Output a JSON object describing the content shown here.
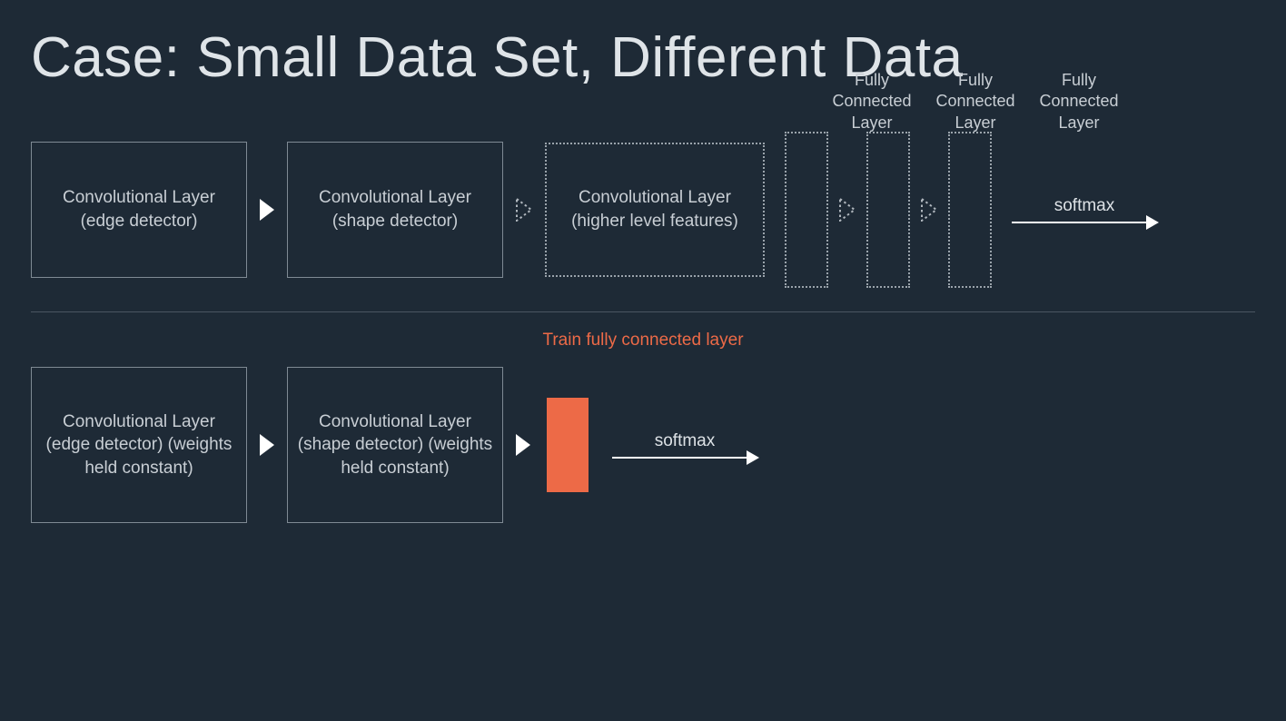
{
  "title": "Case: Small Data Set, Different Data",
  "top": {
    "conv1": "Convolutional Layer (edge detector)",
    "conv2": "Convolutional Layer (shape detector)",
    "conv3": "Convolutional Layer (higher level features)",
    "fc_label": "Fully Connected Layer",
    "softmax": "softmax"
  },
  "caption": "Train fully connected layer",
  "bottom": {
    "conv1": "Convolutional Layer (edge detector) (weights held constant)",
    "conv2": "Convolutional Layer (shape detector) (weights held constant)",
    "softmax": "softmax"
  }
}
